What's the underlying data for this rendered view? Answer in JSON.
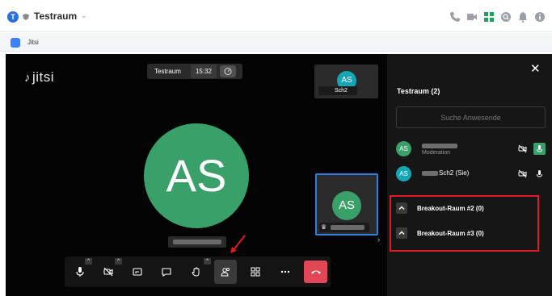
{
  "header": {
    "avatar_letter": "T",
    "room_title": "Testraum",
    "caret": "⌄",
    "icons": [
      "phone-icon",
      "video-camera-icon",
      "apps-grid-icon",
      "search-icon",
      "bell-icon",
      "info-icon"
    ]
  },
  "tab": {
    "label": "Jitsi"
  },
  "meeting": {
    "logo": "jitsi",
    "subject": "Testraum",
    "time": "15:32",
    "main_avatar": "AS",
    "top_thumb_avatar": "AS",
    "top_thumb_label": "Sch2",
    "self_avatar": "AS"
  },
  "toolbar": {
    "buttons": [
      "microphone",
      "camera-off",
      "share-screen",
      "chat",
      "raise-hand",
      "participants",
      "tile-view",
      "more",
      "hangup"
    ]
  },
  "panel": {
    "close": "✕",
    "title": "Testraum (2)",
    "search_placeholder": "Suche Anwesende",
    "participants": [
      {
        "avatar": "AS",
        "role": "Moderation",
        "color": "#3aa06a"
      },
      {
        "avatar": "AS",
        "name": "Sch2 (Sie)",
        "color": "#14a6b4"
      }
    ],
    "breakout_rooms": [
      "Breakout-Raum #2 (0)",
      "Breakout-Raum #3 (0)"
    ]
  },
  "colors": {
    "accent_blue": "#2d7fe0",
    "avatar_green": "#3aa06a",
    "avatar_teal": "#14a6b4",
    "hangup_red": "#e04757",
    "highlight_red": "#e01b24"
  }
}
